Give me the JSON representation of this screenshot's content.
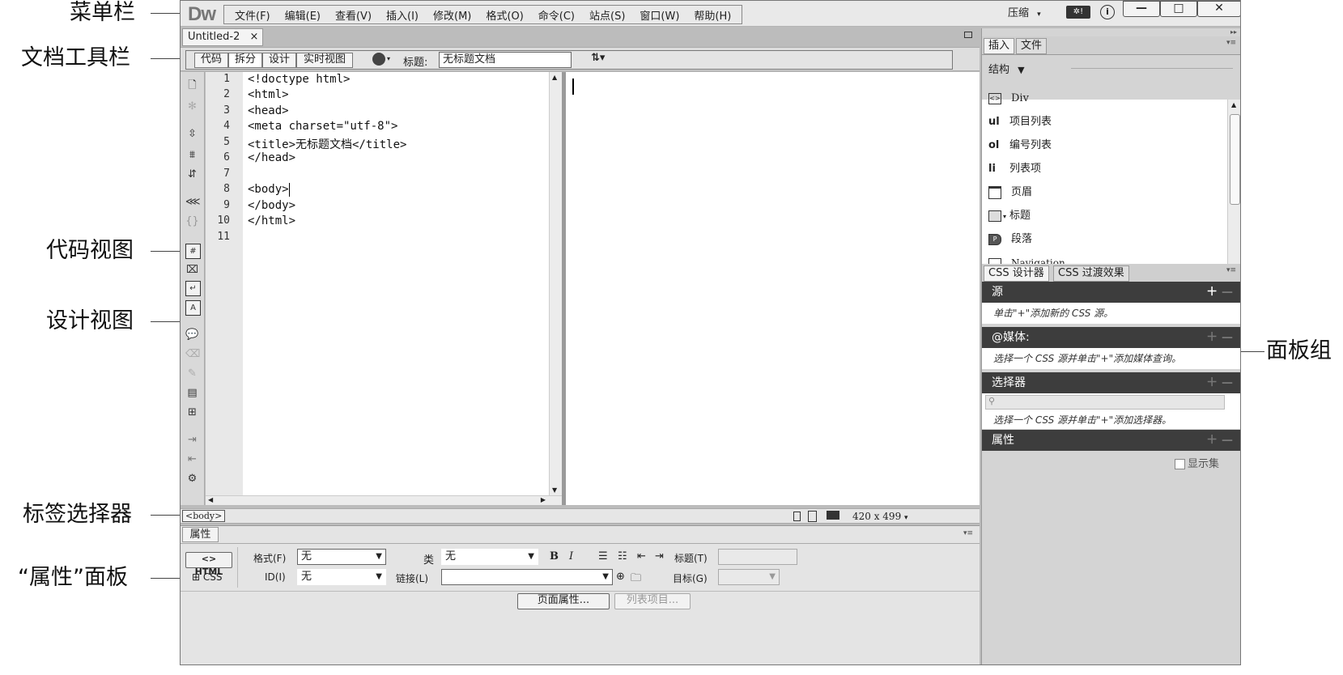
{
  "callouts": {
    "menubar": "菜单栏",
    "doc_toolbar": "文档工具栏",
    "code_view": "代码视图",
    "design_view": "设计视图",
    "tag_selector": "标签选择器",
    "props_panel": "“属性”面板",
    "panel_group": "面板组"
  },
  "app": {
    "logo": "Dw",
    "menu": [
      "文件(F)",
      "编辑(E)",
      "查看(V)",
      "插入(I)",
      "修改(M)",
      "格式(O)",
      "命令(C)",
      "站点(S)",
      "窗口(W)",
      "帮助(H)"
    ],
    "compress": "压缩",
    "window_buttons": [
      "—",
      "□",
      "✕"
    ]
  },
  "document": {
    "tab_title": "Untitled-2",
    "tab_close": "×",
    "view_buttons": [
      "代码",
      "拆分",
      "设计",
      "实时视图"
    ],
    "title_label": "标题:",
    "title_value": "无标题文档",
    "code_lines": [
      "<!doctype html>",
      "<html>",
      "<head>",
      "<meta charset=\"utf-8\">",
      "<title>无标题文档</title>",
      "</head>",
      "",
      "<body>",
      "</body>",
      "</html>",
      ""
    ],
    "line_numbers": [
      "1",
      "2",
      "3",
      "4",
      "5",
      "6",
      "7",
      "8",
      "9",
      "10",
      "11"
    ],
    "status_tag": "<body>",
    "window_size": "420 x 499"
  },
  "properties": {
    "tab": "属性",
    "html_btn": "<> HTML",
    "css_btn": "CSS",
    "format_label": "格式(F)",
    "format_value": "无",
    "class_label": "类",
    "class_value": "无",
    "bold": "B",
    "italic": "I",
    "title_label": "标题(T)",
    "id_label": "ID(I)",
    "id_value": "无",
    "link_label": "链接(L)",
    "target_label": "目标(G)",
    "page_props": "页面属性...",
    "list_item": "列表项目..."
  },
  "panel": {
    "insert_tab": "插入",
    "files_tab": "文件",
    "category": "结构",
    "insert_items": [
      {
        "icon": "<>",
        "label": "Div"
      },
      {
        "icon": "ul",
        "label": "项目列表"
      },
      {
        "icon": "ol",
        "label": "编号列表"
      },
      {
        "icon": "li",
        "label": "列表项"
      },
      {
        "icon": "",
        "label": "页眉"
      },
      {
        "icon": "",
        "label": "标题"
      },
      {
        "icon": "P",
        "label": "段落"
      },
      {
        "icon": "",
        "label": "Navigation"
      }
    ],
    "css_tab": "CSS 设计器",
    "css_trans_tab": "CSS 过渡效果",
    "source_head": "源",
    "source_hint": "单击\"+\"添加新的 CSS 源。",
    "media_head": "@媒体:",
    "media_hint": "选择一个 CSS 源并单击\"+\"添加媒体查询。",
    "selector_head": "选择器",
    "selector_hint": "选择一个 CSS 源并单击\"+\"添加选择器。",
    "props_head": "属性",
    "show_set": "显示集"
  }
}
